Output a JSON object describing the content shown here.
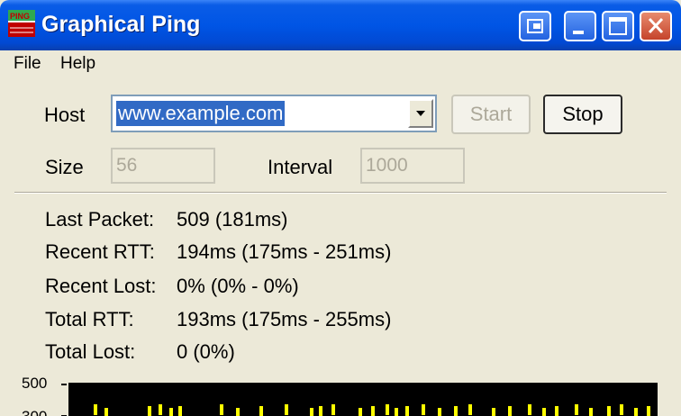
{
  "window": {
    "title": "Graphical Ping",
    "icon": "ping-app-icon",
    "controls": [
      "restore-icon",
      "minimize-icon",
      "maximize-icon",
      "close-icon"
    ]
  },
  "menu": {
    "file": "File",
    "help": "Help"
  },
  "form": {
    "host_label": "Host",
    "host_value": "www.example.com",
    "start_label": "Start",
    "stop_label": "Stop",
    "size_label": "Size",
    "size_value": "56",
    "interval_label": "Interval",
    "interval_value": "1000"
  },
  "stats": [
    {
      "label": "Last Packet:",
      "value": "509 (181ms)"
    },
    {
      "label": "Recent RTT:",
      "value": "194ms (175ms - 251ms)"
    },
    {
      "label": "Recent Lost:",
      "value": "0% (0% - 0%)"
    },
    {
      "label": "Total RTT:",
      "value": "193ms (175ms - 255ms)"
    },
    {
      "label": "Total Lost:",
      "value": "0 (0%)"
    }
  ],
  "graph": {
    "y_ticks": [
      "500",
      "300"
    ],
    "background": "#000000",
    "line_color": "#ffff00"
  },
  "colors": {
    "titlebar": "#0055e5",
    "face": "#ece9d8",
    "selection": "#316ac5"
  }
}
